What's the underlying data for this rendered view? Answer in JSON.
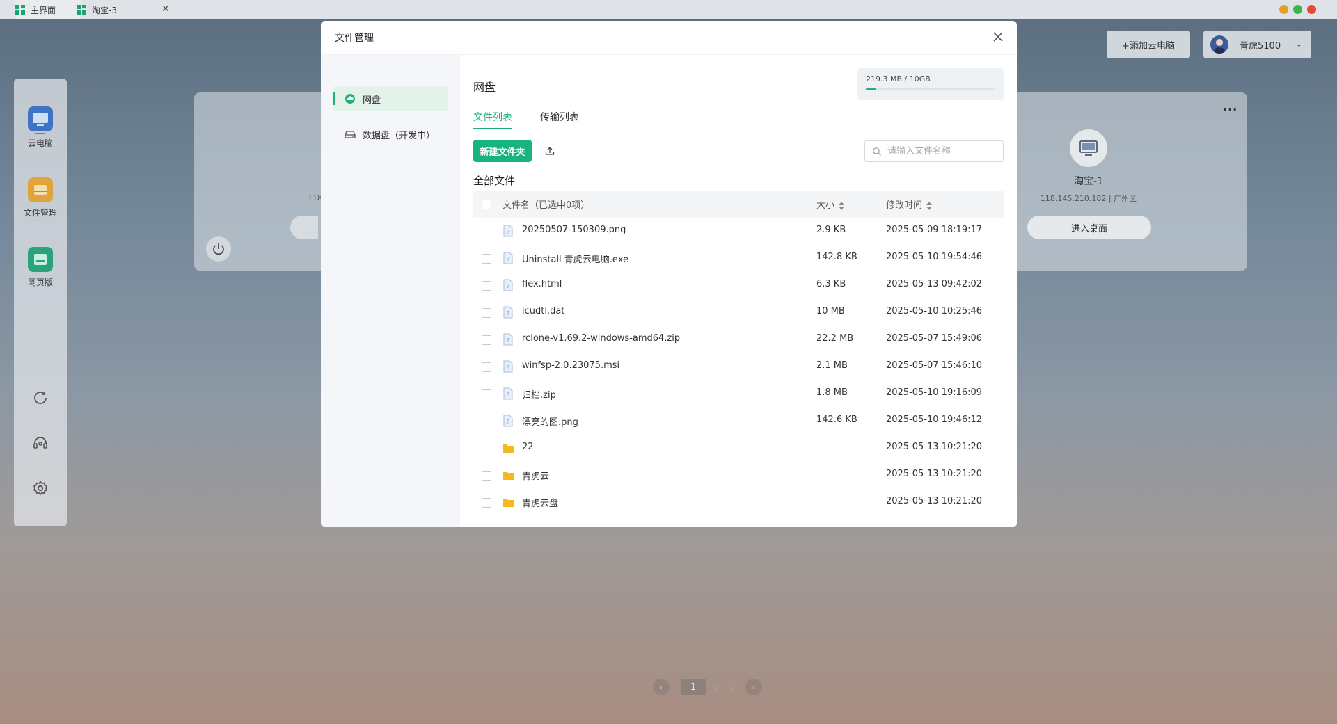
{
  "titlebar": {
    "tabs": [
      {
        "label": "主界面"
      },
      {
        "label": "淘宝-3"
      }
    ],
    "window_buttons": {
      "min_color": "#e0a030",
      "max_color": "#3cb54a",
      "close_color": "#e04b3c"
    }
  },
  "dock": {
    "items": [
      {
        "label": "云电脑",
        "icon": "monitor-icon"
      },
      {
        "label": "文件管理",
        "icon": "folder-drive-icon"
      },
      {
        "label": "网页版",
        "icon": "browser-icon"
      }
    ],
    "tools": [
      "refresh-icon",
      "headset-icon",
      "gear-icon"
    ]
  },
  "header": {
    "add_pc_label": "+添加云电脑",
    "username": "青虎5100"
  },
  "background": {
    "ghost_ip": "118",
    "pc_name": "淘宝-1",
    "pc_ip": "118.145.210.182 | 广州区",
    "enter_label": "进入桌面",
    "more_label": "···"
  },
  "pager": {
    "current": "1",
    "separator": "/",
    "total": "1"
  },
  "modal": {
    "title": "文件管理",
    "sidebar": [
      {
        "label": "网盘",
        "icon": "cloud-icon"
      },
      {
        "label": "数据盘（开发中）",
        "icon": "hard-drive-icon"
      }
    ],
    "content_title": "网盘",
    "quota": {
      "text": "219.3 MB / 10GB",
      "used_fraction": 0.021
    },
    "tabs": [
      {
        "label": "文件列表"
      },
      {
        "label": "传输列表"
      }
    ],
    "new_folder_label": "新建文件夹",
    "search_placeholder": "请输入文件名称",
    "section_label": "全部文件",
    "columns": {
      "name": "文件名（已选中0项）",
      "size": "大小",
      "time": "修改时间"
    },
    "files": [
      {
        "name": "20250507-150309.png",
        "size": "2.9 KB",
        "time": "2025-05-09 18:19:17",
        "type": "file"
      },
      {
        "name": "Uninstall 青虎云电脑.exe",
        "size": "142.8 KB",
        "time": "2025-05-10 19:54:46",
        "type": "file"
      },
      {
        "name": "flex.html",
        "size": "6.3 KB",
        "time": "2025-05-13 09:42:02",
        "type": "file"
      },
      {
        "name": "icudtl.dat",
        "size": "10 MB",
        "time": "2025-05-10 10:25:46",
        "type": "file"
      },
      {
        "name": "rclone-v1.69.2-windows-amd64.zip",
        "size": "22.2 MB",
        "time": "2025-05-07 15:49:06",
        "type": "file"
      },
      {
        "name": "winfsp-2.0.23075.msi",
        "size": "2.1 MB",
        "time": "2025-05-07 15:46:10",
        "type": "file"
      },
      {
        "name": "归档.zip",
        "size": "1.8 MB",
        "time": "2025-05-10 19:16:09",
        "type": "file"
      },
      {
        "name": "漂亮的图.png",
        "size": "142.6 KB",
        "time": "2025-05-10 19:46:12",
        "type": "file"
      },
      {
        "name": "22",
        "size": "",
        "time": "2025-05-13 10:21:20",
        "type": "folder"
      },
      {
        "name": "青虎云",
        "size": "",
        "time": "2025-05-13 10:21:20",
        "type": "folder"
      },
      {
        "name": "青虎云盘",
        "size": "",
        "time": "2025-05-13 10:21:20",
        "type": "folder"
      }
    ]
  }
}
